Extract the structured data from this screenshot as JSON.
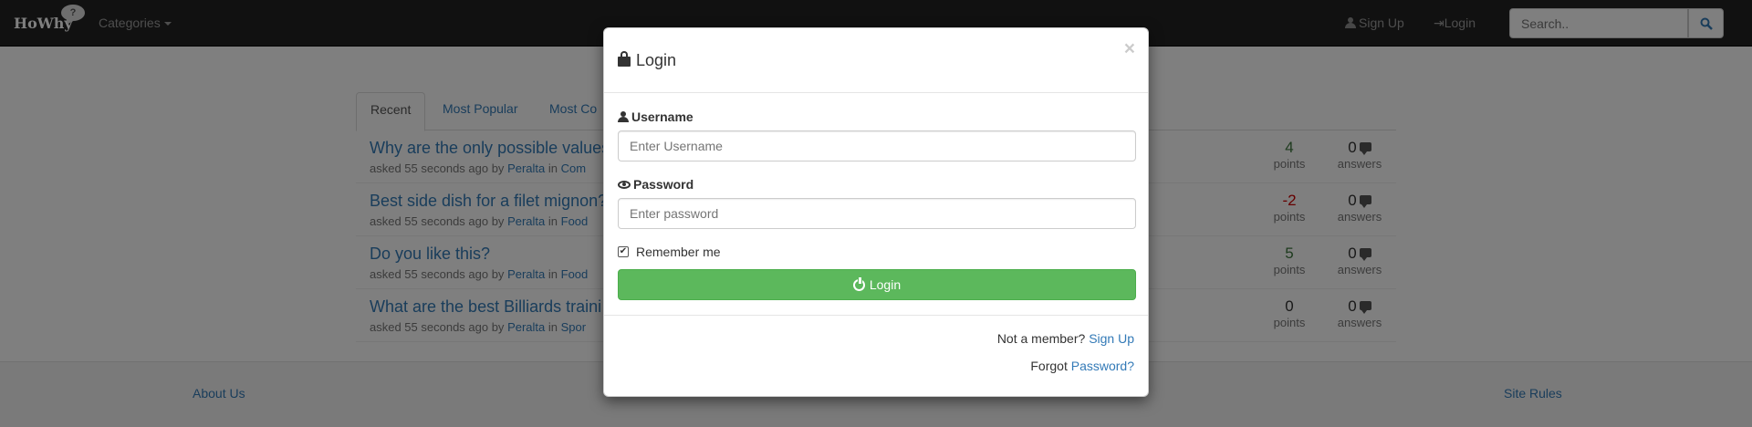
{
  "navbar": {
    "brand": "HoWhy",
    "brand_badge": "?",
    "categories_label": "Categories",
    "signup_label": "Sign Up",
    "login_label": "Login",
    "search_placeholder": "Search..",
    "search_icon": "search-icon"
  },
  "tabs": [
    {
      "label": "Recent",
      "active": true
    },
    {
      "label": "Most Popular",
      "active": false
    },
    {
      "label": "Most Co",
      "active": false
    }
  ],
  "questions": [
    {
      "title": "Why are the only possible values",
      "asked": "asked 55 seconds ago by",
      "author": "Peralta",
      "in": "in",
      "category": "Com",
      "points": "4",
      "points_label": "points",
      "answers": "0",
      "answers_label": "answers"
    },
    {
      "title": "Best side dish for a filet mignon?",
      "asked": "asked 55 seconds ago by",
      "author": "Peralta",
      "in": "in",
      "category": "Food",
      "points": "-2",
      "points_label": "points",
      "answers": "0",
      "answers_label": "answers"
    },
    {
      "title": "Do you like this?",
      "asked": "asked 55 seconds ago by",
      "author": "Peralta",
      "in": "in",
      "category": "Food",
      "points": "5",
      "points_label": "points",
      "answers": "0",
      "answers_label": "answers"
    },
    {
      "title": "What are the best Billiards traini",
      "asked": "asked 55 seconds ago by",
      "author": "Peralta",
      "in": "in",
      "category": "Spor",
      "points": "0",
      "points_label": "points",
      "answers": "0",
      "answers_label": "answers"
    }
  ],
  "footer": {
    "about_label": "About Us",
    "rules_label": "Site Rules"
  },
  "modal": {
    "title": "Login",
    "close_label": "×",
    "username_label": "Username",
    "username_placeholder": "Enter Username",
    "password_label": "Password",
    "password_placeholder": "Enter password",
    "remember_label": "Remember me",
    "remember_checked": true,
    "login_button_label": "Login",
    "not_member_text": "Not a member?",
    "signup_link": "Sign Up",
    "forgot_text": "Forgot",
    "password_link": "Password?"
  },
  "colors": {
    "navbar_bg": "#222222",
    "link": "#337ab7",
    "success": "#5cb85c",
    "positive_points": "#3c763d",
    "negative_points": "#cc0000"
  }
}
